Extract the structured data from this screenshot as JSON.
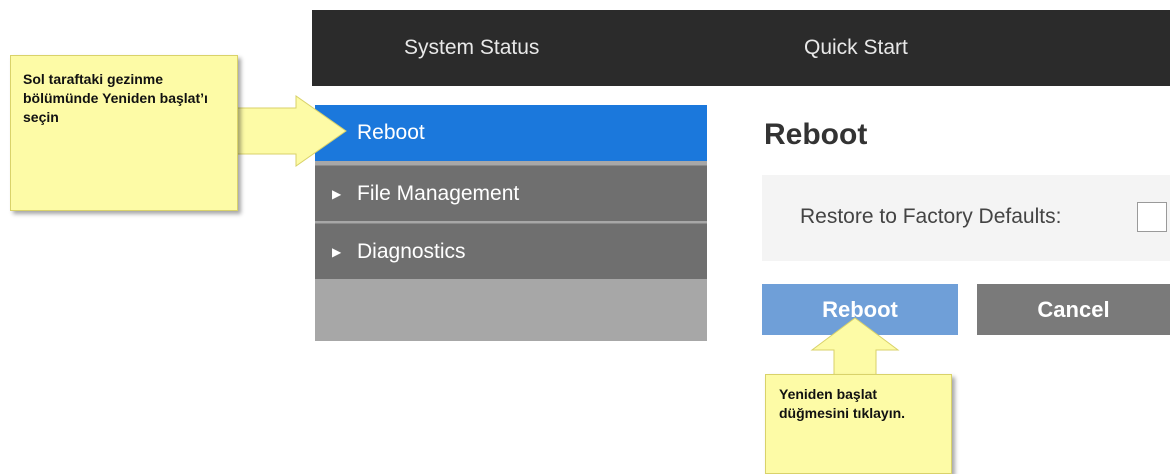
{
  "topnav": {
    "items": [
      "System Status",
      "Quick Start"
    ]
  },
  "sidebar": {
    "items": [
      {
        "label": "Reboot",
        "active": true
      },
      {
        "label": "File Management",
        "active": false
      },
      {
        "label": "Diagnostics",
        "active": false
      }
    ]
  },
  "main": {
    "title": "Reboot",
    "restore_label": "Restore to Factory Defaults:",
    "restore_checked": false,
    "reboot_button": "Reboot",
    "cancel_button": "Cancel"
  },
  "callouts": {
    "sidebar_hint": "Sol taraftaki gezinme bölümünde Yeniden başlat’ı seçin",
    "button_hint": "Yeniden başlat düğmesini tıklayın."
  },
  "colors": {
    "topbar": "#2b2b2b",
    "active_item": "#1b78dc",
    "reboot_button": "#6f9fd8",
    "cancel_button": "#7a7a7a",
    "callout": "#fdfba6"
  }
}
